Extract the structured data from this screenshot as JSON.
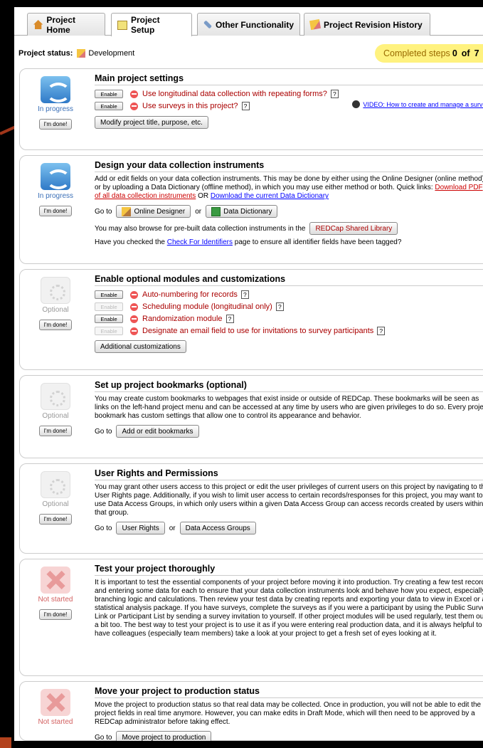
{
  "tabs": [
    {
      "label": "Project Home",
      "icon": "home-icon"
    },
    {
      "label": "Project Setup",
      "icon": "setup-icon"
    },
    {
      "label": "Other Functionality",
      "icon": "wrench-icon"
    },
    {
      "label": "Project Revision History",
      "icon": "pencil-icon"
    }
  ],
  "status": {
    "label": "Project status:",
    "value": "Development"
  },
  "completed": {
    "prefix": "Completed steps",
    "count": "0",
    "of": "of",
    "total": "7"
  },
  "colors": {
    "accent_yellow": "#fff27f",
    "in_progress": "#3a6fb7",
    "not_started": "#d36060",
    "option_red": "#aa0000"
  },
  "common": {
    "done_label": "I'm done!",
    "enable_label": "Enable",
    "go_to": "Go to",
    "or": "or",
    "help": "?"
  },
  "panels": {
    "main": {
      "status": "In progress",
      "title": "Main project settings",
      "opt1": "Use longitudinal data collection with repeating forms?",
      "opt2": "Use surveys in this project?",
      "video": "VIDEO: How to create and manage a survey",
      "modify_btn": "Modify project title, purpose, etc."
    },
    "design": {
      "status": "In progress",
      "title": "Design your data collection instruments",
      "desc": "Add or edit fields on your data collection instruments. This may be done by either using the Online Designer (online method) or by uploading a Data Dictionary (offline method), in which you may use either method or both. Quick links:",
      "link_pdf": "Download PDF of all data collection instruments",
      "or_upper": "OR",
      "link_dd": "Download the current Data Dictionary",
      "online_designer": "Online Designer",
      "data_dictionary": "Data Dictionary",
      "library_prefix": "You may also browse for pre-built data collection instruments in the",
      "library_btn": "REDCap Shared Library",
      "identifiers_prefix": "Have you checked the",
      "identifiers_link": "Check For Identifiers",
      "identifiers_suffix": "page to ensure all identifier fields have been tagged?"
    },
    "optional": {
      "status": "Optional",
      "title": "Enable optional modules and customizations",
      "opt1": "Auto-numbering for records",
      "opt2": "Scheduling module (longitudinal only)",
      "opt3": "Randomization module",
      "opt4": "Designate an email field to use for invitations to survey participants",
      "custom_btn": "Additional customizations"
    },
    "bookmarks": {
      "status": "Optional",
      "title": "Set up project bookmarks (optional)",
      "desc": "You may create custom bookmarks to webpages that exist inside or outside of REDCap. These bookmarks will be seen as links on the left-hand project menu and can be accessed at any time by users who are given privileges to do so. Every project bookmark has custom settings that allow one to control its appearance and behavior.",
      "btn": "Add or edit bookmarks"
    },
    "rights": {
      "status": "Optional",
      "title": "User Rights and Permissions",
      "desc": "You may grant other users access to this project or edit the user privileges of current users on this project by navigating to the User Rights page. Additionally, if you wish to limit user access to certain records/responses for this project, you may want to use Data Access Groups, in which only users within a given Data Access Group can access records created by users within that group.",
      "btn1": "User Rights",
      "btn2": "Data Access Groups"
    },
    "test": {
      "status": "Not started",
      "title": "Test your project thoroughly",
      "desc": "It is important to test the essential components of your project before moving it into production. Try creating a few test records and entering some data for each to ensure that your data collection instruments look and behave how you expect, especially branching logic and calculations. Then review your test data by creating reports and exporting your data to view in Excel or a statistical analysis package. If you have surveys, complete the surveys as if you were a participant by using the Public Survey Link or Participant List by sending a survey invitation to yourself. If other project modules will be used regularly, test them out a bit too. The best way to test your project is to use it as if you were entering real production data, and it is always helpful to have colleagues (especially team members) take a look at your project to get a fresh set of eyes looking at it."
    },
    "production": {
      "status": "Not started",
      "title": "Move your project to production status",
      "desc": "Move the project to production status so that real data may be collected. Once in production, you will not be able to edit the project fields in real time anymore. However, you can make edits in Draft Mode, which will then need to be approved by a REDCap administrator before taking effect.",
      "btn": "Move project to production"
    }
  }
}
